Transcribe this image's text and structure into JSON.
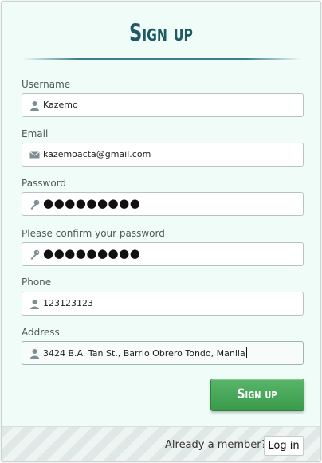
{
  "form": {
    "title": "Sign up",
    "fields": [
      {
        "label": "Username",
        "value": "Kazemo",
        "icon": "user-icon"
      },
      {
        "label": "Email",
        "value": "kazemoacta@gmail.com",
        "icon": "envelope-icon"
      },
      {
        "label": "Password",
        "value": "●●●●●●●●●",
        "icon": "key-icon"
      },
      {
        "label": "Please confirm your password",
        "value": "●●●●●●●●●",
        "icon": "key-icon"
      },
      {
        "label": "Phone",
        "value": "123123123",
        "icon": "user-icon"
      },
      {
        "label": "Address",
        "value": "3424 B.A. Tan St., Barrio Obrero Tondo, Manila",
        "icon": "user-icon"
      }
    ],
    "submit_label": "Sign up"
  },
  "footer": {
    "member_text": "Already a member?",
    "login_label": "Log in"
  },
  "colors": {
    "accent": "#1e5a66",
    "button_green": "#45a657",
    "background": "#f0fcf8"
  }
}
